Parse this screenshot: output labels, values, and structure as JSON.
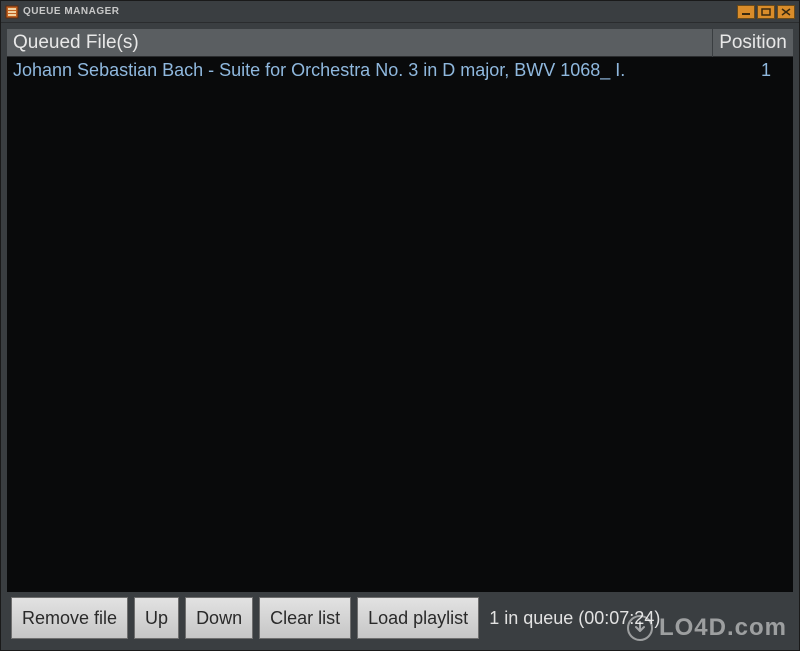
{
  "window": {
    "title": "QUEUE MANAGER"
  },
  "header": {
    "files_label": "Queued File(s)",
    "position_label": "Position"
  },
  "queue": {
    "items": [
      {
        "name": "Johann Sebastian Bach - Suite for Orchestra No. 3 in D major, BWV 1068_ I.",
        "position": "1"
      }
    ]
  },
  "buttons": {
    "remove": "Remove file",
    "up": "Up",
    "down": "Down",
    "clear": "Clear list",
    "load": "Load playlist"
  },
  "status": {
    "text": "1 in queue (00:07:24)"
  },
  "watermark": {
    "text": "LO4D.com"
  }
}
